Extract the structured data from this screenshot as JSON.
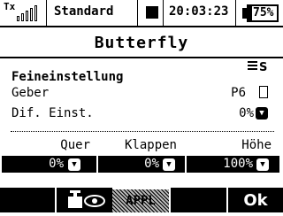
{
  "status": {
    "tx_label": "Tx",
    "model_name": "Standard",
    "clock": "20:03:23",
    "battery": "75%",
    "battery_level": 0.75,
    "signal_bars": 5
  },
  "page": {
    "title": "Butterfly"
  },
  "fine_tuning": {
    "heading": "Feineinstellung",
    "switch_icon": "switch-s-icon",
    "rows": [
      {
        "label": "Geber",
        "value": "P6"
      },
      {
        "label": "Dif. Einst.",
        "value": "0%"
      }
    ]
  },
  "mix": {
    "columns": [
      {
        "header": "Quer",
        "value": "0%"
      },
      {
        "header": "Klappen",
        "value": "0%"
      },
      {
        "header": "Höhe",
        "value": "100%"
      }
    ]
  },
  "softkeys": {
    "left": "model-eye-icon",
    "center": "APPL",
    "right": "Ok"
  }
}
